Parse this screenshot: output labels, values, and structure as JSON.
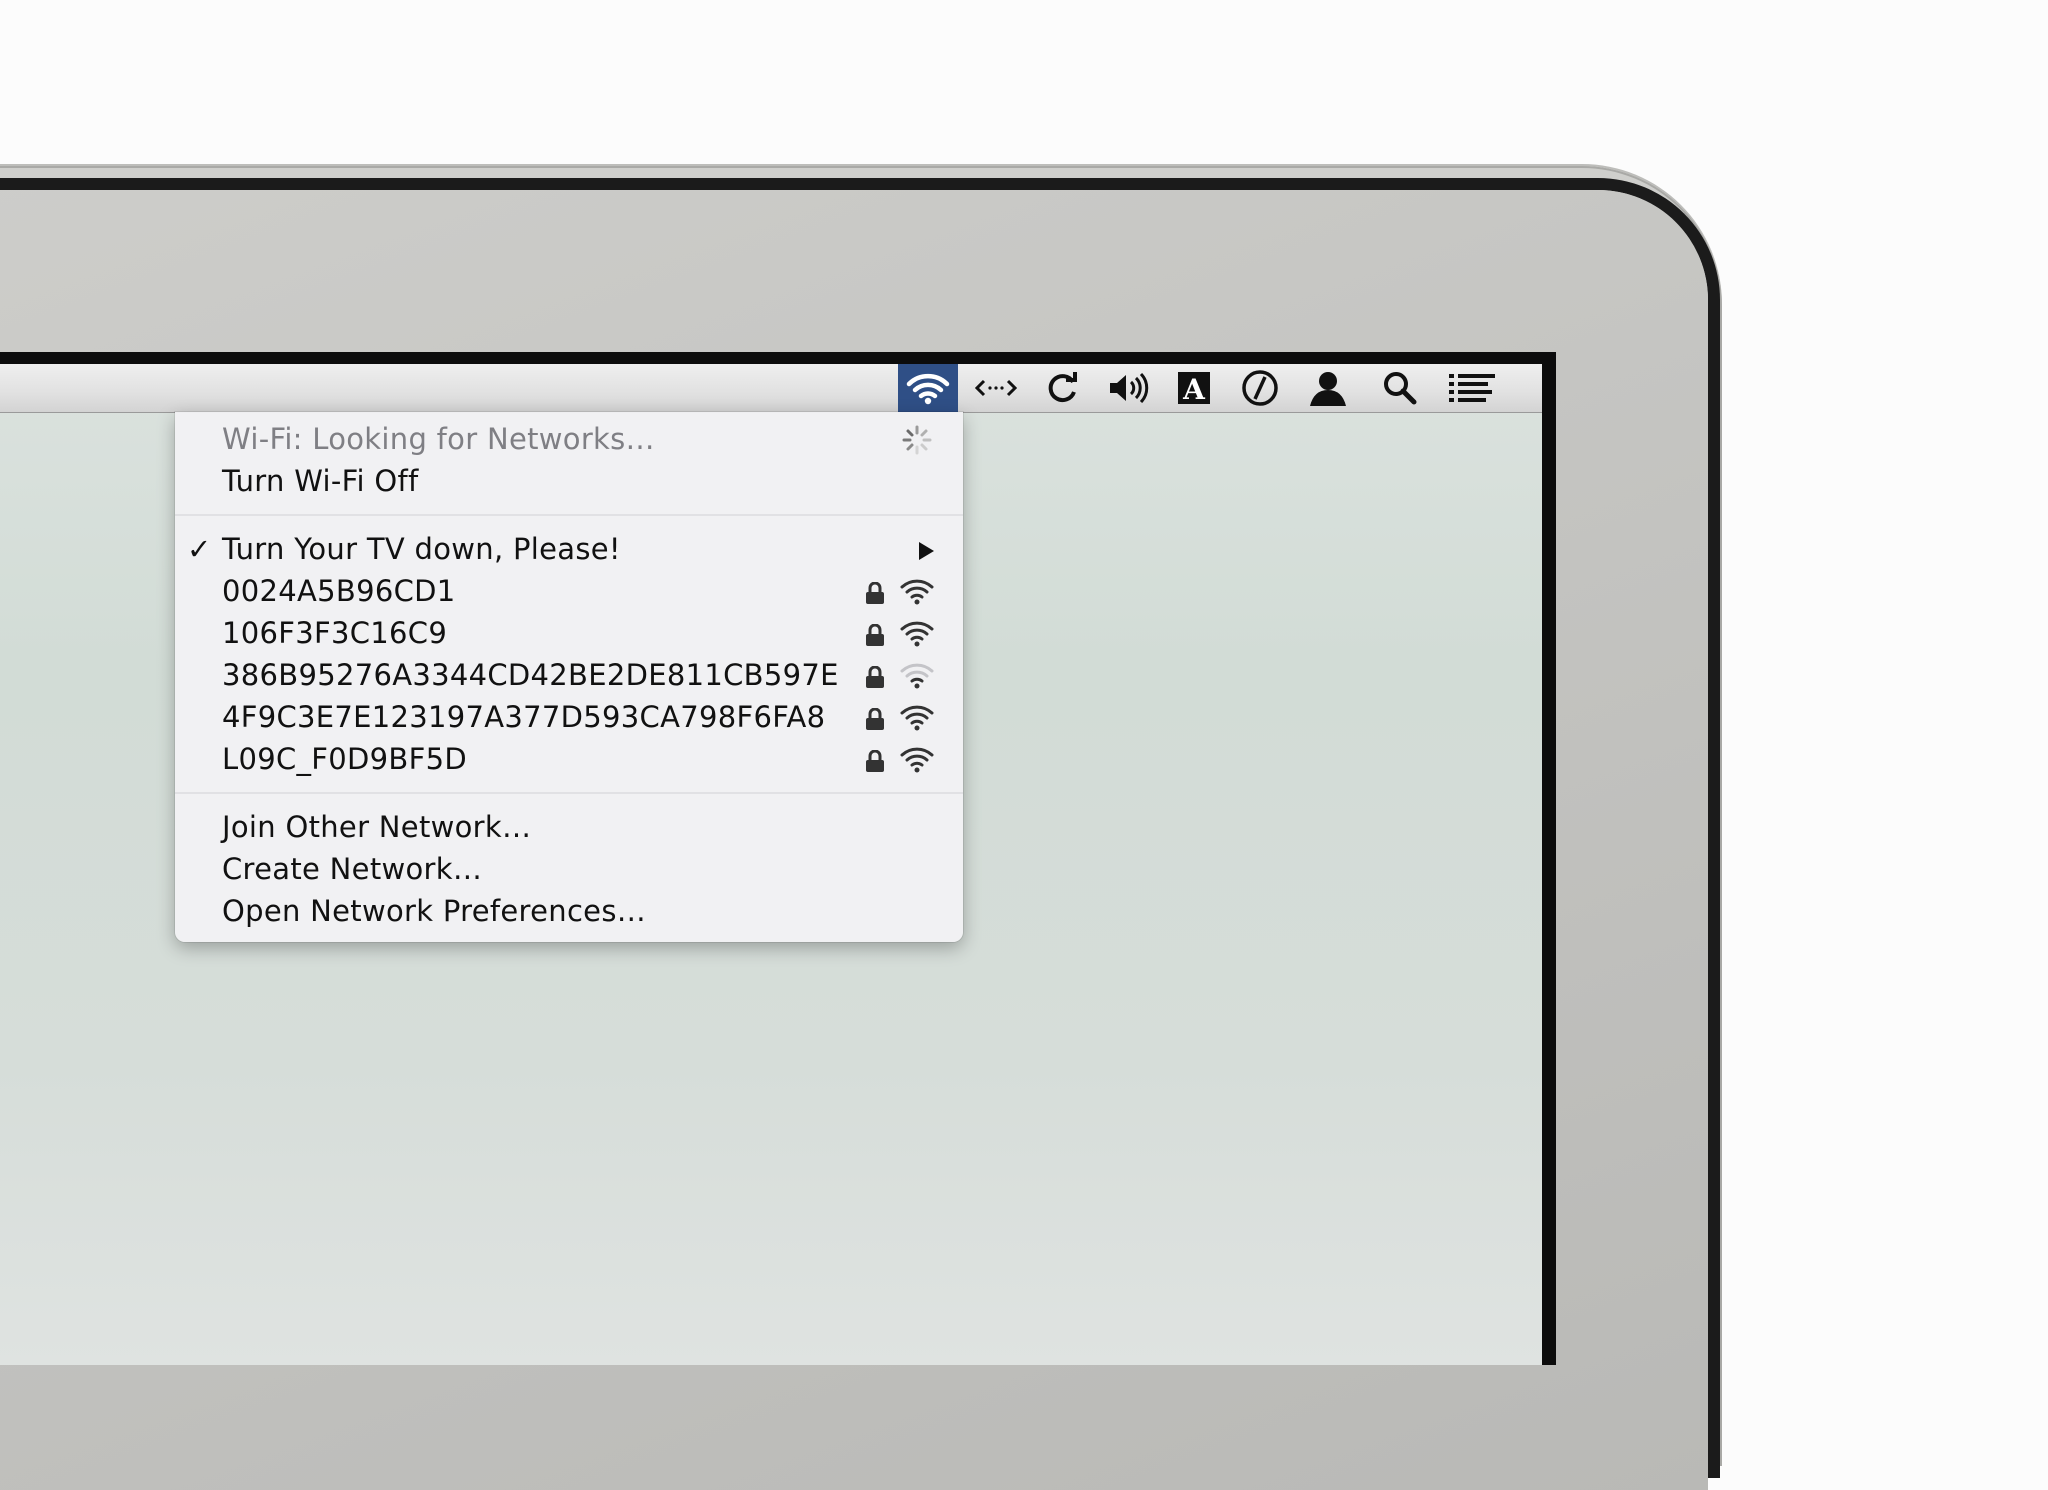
{
  "menubar": {
    "icons": [
      {
        "name": "wifi-icon",
        "active": true
      },
      {
        "name": "arrows-icon",
        "glyph": "<·>"
      },
      {
        "name": "time-machine-icon",
        "glyph": "⟳"
      },
      {
        "name": "volume-icon",
        "glyph": "🔊"
      },
      {
        "name": "input-source-icon",
        "glyph": "A"
      },
      {
        "name": "clock-icon"
      },
      {
        "name": "user-icon"
      },
      {
        "name": "spotlight-search-icon"
      },
      {
        "name": "notification-center-icon"
      }
    ]
  },
  "wifi_menu": {
    "status": "Wi-Fi: Looking for Networks…",
    "toggle": "Turn Wi-Fi Off",
    "current_network": "Turn Your TV down, Please!",
    "networks": [
      {
        "name": "0024A5B96CD1",
        "locked": true,
        "signal": 3
      },
      {
        "name": "106F3F3C16C9",
        "locked": true,
        "signal": 3
      },
      {
        "name": "386B95276A3344CD42BE2DE811CB597E",
        "locked": true,
        "signal": 1
      },
      {
        "name": "4F9C3E7E123197A377D593CA798F6FA8",
        "locked": true,
        "signal": 3
      },
      {
        "name": "L09C_F0D9BF5D",
        "locked": true,
        "signal": 3
      }
    ],
    "actions": {
      "join_other": "Join Other Network…",
      "create": "Create Network…",
      "preferences": "Open Network Preferences…"
    }
  },
  "colors": {
    "menubar_active": "#2f4f86",
    "menu_bg": "#f2f2f4",
    "disabled_text": "#7f7f84",
    "bezel": "#c4c4c1"
  }
}
